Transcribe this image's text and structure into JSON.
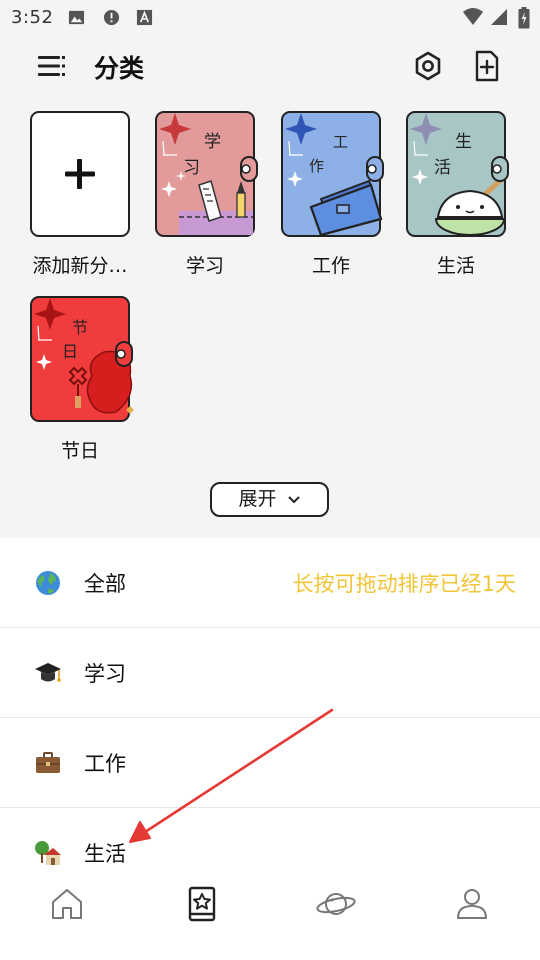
{
  "status_bar": {
    "time": "3:52",
    "icons": [
      "image-icon",
      "alert-icon",
      "font-icon",
      "wifi-icon",
      "signal-icon",
      "battery-icon"
    ]
  },
  "header": {
    "title": "分类",
    "menu_icon": "menu-icon",
    "settings_icon": "settings-icon",
    "add_icon": "add-document-icon"
  },
  "categories": [
    {
      "label": "添加新分…",
      "chars": [],
      "color": "#ffffff",
      "decor": "plus"
    },
    {
      "label": "学习",
      "chars": [
        "学",
        "习"
      ],
      "color": "#e39a9a",
      "decor": "ruler"
    },
    {
      "label": "工作",
      "chars": [
        "工",
        "作"
      ],
      "color": "#8db0e6",
      "decor": "briefcase"
    },
    {
      "label": "生活",
      "chars": [
        "生",
        "活"
      ],
      "color": "#a8c6c6",
      "decor": "rice-bowl"
    },
    {
      "label": "节日",
      "chars": [
        "节",
        "日"
      ],
      "color": "#f03c3c",
      "decor": "chinese-knot"
    }
  ],
  "expand_button": {
    "label": "展开"
  },
  "list": {
    "hint": "长按可拖动排序已经1天",
    "items": [
      {
        "label": "全部",
        "icon": "globe-icon"
      },
      {
        "label": "学习",
        "icon": "graduation-cap-icon"
      },
      {
        "label": "工作",
        "icon": "briefcase-icon"
      },
      {
        "label": "生活",
        "icon": "house-icon"
      }
    ]
  },
  "bottom_nav": {
    "items": [
      "home-icon",
      "notebook-star-icon",
      "planet-icon",
      "profile-icon"
    ],
    "active": "notebook-star-icon"
  },
  "annotation": {
    "color": "#e53935"
  }
}
